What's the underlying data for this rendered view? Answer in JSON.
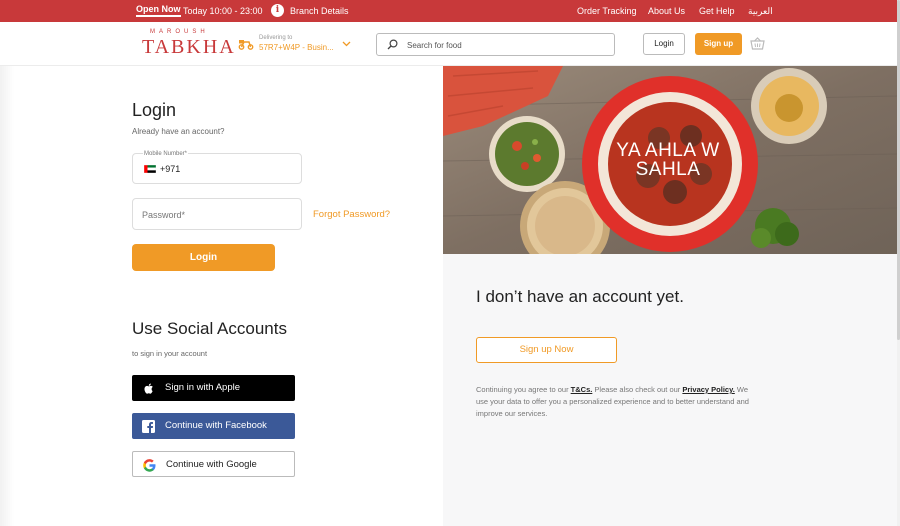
{
  "topbar": {
    "open_badge": "Open Now",
    "hours": "Today 10:00 - 23:00",
    "branch_details": "Branch Details",
    "links": [
      "Order Tracking",
      "About Us",
      "Get Help",
      "العربية"
    ]
  },
  "header": {
    "logo_small": "MAROUSH",
    "logo_big": "TABKHA",
    "delivering_label": "Delivering to",
    "delivering_value": "57R7+W4P - Busin...",
    "search_placeholder": "Search for food",
    "login_label": "Login",
    "signup_label": "Sign up"
  },
  "login": {
    "title": "Login",
    "subtitle": "Already have an account?",
    "mobile_label": "Mobile Number*",
    "country_code": "+971",
    "password_placeholder": "Password*",
    "forgot_password": "Forgot Password?",
    "login_button": "Login"
  },
  "social": {
    "title": "Use Social Accounts",
    "subtitle": "to sign in your account",
    "apple": "Sign in with Apple",
    "facebook": "Continue with Facebook",
    "google": "Continue with Google"
  },
  "signup": {
    "hero_text": "YA AHLA W SAHLA",
    "title": "I don’t have an account yet.",
    "button": "Sign up Now",
    "terms_prefix": "Continuing you agree to our ",
    "terms_link": "T&Cs.",
    "terms_middle": " Please also check out our ",
    "privacy_link": "Privacy Policy.",
    "terms_suffix": " We use your data to offer you a personalized experience and to better understand and improve our services."
  },
  "colors": {
    "brand_red": "#c8393a",
    "accent_orange": "#f09a26",
    "facebook_blue": "#3b5998",
    "apple_black": "#000000"
  },
  "icons": [
    "info-icon",
    "delivery-scooter-icon",
    "chevron-down-icon",
    "search-icon",
    "cart-icon",
    "uae-flag-icon",
    "apple-icon",
    "facebook-icon",
    "google-icon"
  ]
}
